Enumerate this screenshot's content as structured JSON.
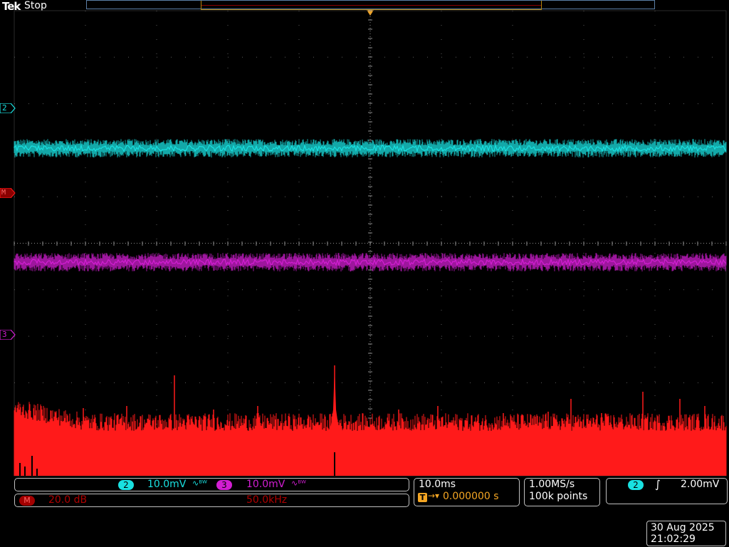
{
  "header": {
    "brand": "Tek",
    "run_state": "Stop"
  },
  "colors": {
    "ch2": "#19e0e0",
    "ch3": "#d21ed2",
    "math": "#ff1a1a",
    "trigger": "#f5a623",
    "graticule": "#8c8c8c"
  },
  "markers": {
    "ch2_label": "2",
    "math_label": "M",
    "ch3_label": "3"
  },
  "waveforms": {
    "ch2": {
      "level_div": 2.05,
      "noise": "dense-band"
    },
    "ch3": {
      "level_div": -0.4,
      "noise": "dense-band"
    },
    "math": {
      "type": "FFT",
      "spectrum": "noise-floor-with-spurs"
    }
  },
  "vertical": {
    "ch2_label": "2",
    "ch2_scale": "10.0mV",
    "ch3_label": "3",
    "ch3_scale": "10.0mV",
    "coupling_symbol": "∿ᴮᵂ"
  },
  "math_readout": {
    "label": "M",
    "scale": "20.0 dB",
    "span": "50.0kHz"
  },
  "horizontal": {
    "scale": "10.0ms",
    "trigger_symbol": "T",
    "arrow": "→▾",
    "delay": "0.000000 s"
  },
  "acquisition": {
    "sample_rate": "1.00MS/s",
    "record_length": "100k points"
  },
  "trigger": {
    "source_label": "2",
    "slope_symbol": "∫",
    "level": "2.00mV"
  },
  "datetime": {
    "date": "30 Aug 2025",
    "time": "21:02:29"
  }
}
